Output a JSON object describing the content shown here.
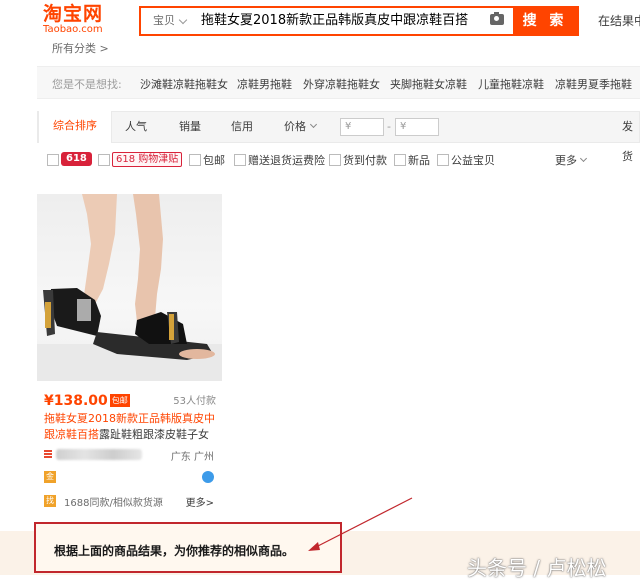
{
  "header": {
    "logo_cn": "淘宝网",
    "logo_en": "Taobao.com",
    "search_scope": "宝贝",
    "search_query": "拖鞋女夏2018新款正品韩版真皮中跟凉鞋百搭",
    "search_button": "搜 索",
    "in_results": "在结果中"
  },
  "category": "所有分类 >",
  "suggest": {
    "label": "您是不是想找:",
    "items": [
      "沙滩鞋凉鞋拖鞋女",
      "凉鞋男拖鞋",
      "外穿凉鞋拖鞋女",
      "夹脚拖鞋女凉鞋",
      "儿童拖鞋凉鞋",
      "凉鞋男夏季拖鞋"
    ]
  },
  "sort": {
    "items": [
      "综合排序",
      "人气",
      "销量",
      "信用",
      "价格"
    ],
    "price_from": "¥",
    "price_to": "¥",
    "dash": "-",
    "ship_from": "发货"
  },
  "filters": {
    "badge_618": "618",
    "badge_618_subsidy": "618 购物津贴",
    "items": [
      "包邮",
      "赠送退货运费险",
      "货到付款",
      "新品",
      "公益宝贝"
    ],
    "more": "更多"
  },
  "product": {
    "price": "¥138.00",
    "price_tag": "包邮",
    "sales": "53人付款",
    "title_highlight": "拖鞋女夏2018新款正品韩版真皮中跟凉鞋百搭",
    "title_rest": "露趾鞋粗跟漆皮鞋子女",
    "location": "广东 广州",
    "gold_icon": "金",
    "similar_icon": "找",
    "similar_text": "1688同款/相似款货源",
    "similar_more": "更多>"
  },
  "recommend": {
    "text": "根据上面的商品结果，为你推荐的相似商品。"
  },
  "watermark": "头条号 / 卢松松",
  "colors": {
    "brand": "#ff4400",
    "highlight_box": "#c1272d",
    "badge_red": "#d8223a"
  }
}
